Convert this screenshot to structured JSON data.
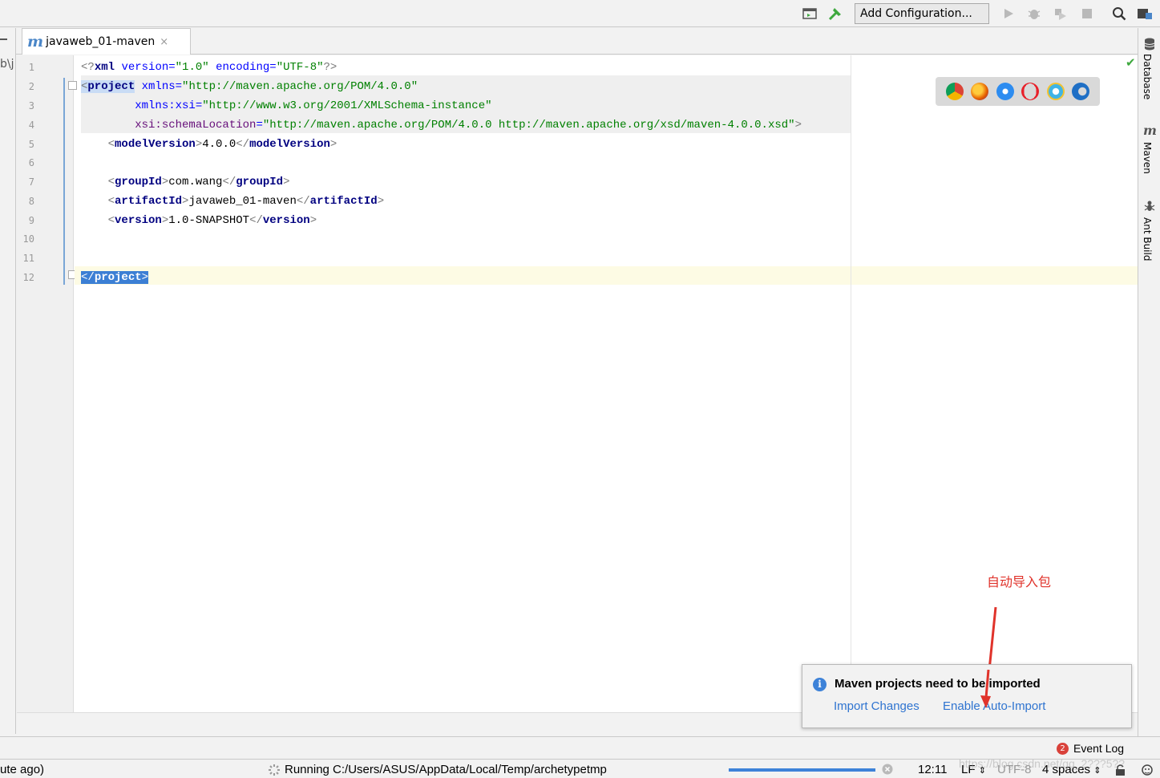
{
  "toolbar": {
    "add_configuration_label": "Add Configuration...",
    "icons": [
      "project-structure-icon",
      "build-hammer-icon",
      "run-icon",
      "debug-icon",
      "coverage-icon",
      "stop-icon",
      "search-icon",
      "project-settings-icon"
    ]
  },
  "left_edge": {
    "clipped_text": "b\\j"
  },
  "tab": {
    "prefix": "m",
    "label": "javaweb_01-maven",
    "close": "×"
  },
  "editor": {
    "line_numbers": [
      "1",
      "2",
      "3",
      "4",
      "5",
      "6",
      "7",
      "8",
      "9",
      "10",
      "11",
      "12"
    ],
    "lines": [
      [
        "<?",
        "xml",
        " ",
        "version",
        "=",
        "\"1.0\"",
        " ",
        "encoding",
        "=",
        "\"UTF-8\"",
        "?>"
      ],
      [
        "<",
        "project",
        " ",
        "xmlns",
        "=",
        "\"http://maven.apache.org/POM/4.0.0\""
      ],
      [
        "        ",
        "xmlns:xsi",
        "=",
        "\"http://www.w3.org/2001/XMLSchema-instance\""
      ],
      [
        "        ",
        "xsi:schemaLocation",
        "=",
        "\"http://maven.apache.org/POM/4.0.0 http://maven.apache.org/xsd/maven-4.0.0.xsd\"",
        ">"
      ],
      [
        "    ",
        "<",
        "modelVersion",
        ">",
        "4.0.0",
        "</",
        "modelVersion",
        ">"
      ],
      [
        ""
      ],
      [
        "    ",
        "<",
        "groupId",
        ">",
        "com.wang",
        "</",
        "groupId",
        ">"
      ],
      [
        "    ",
        "<",
        "artifactId",
        ">",
        "javaweb_01-maven",
        "</",
        "artifactId",
        ">"
      ],
      [
        "    ",
        "<",
        "version",
        ">",
        "1.0-SNAPSHOT",
        "</",
        "version",
        ">"
      ],
      [
        ""
      ],
      [
        ""
      ],
      [
        "</",
        "project",
        ">"
      ]
    ]
  },
  "right_sidebar": {
    "database": "Database",
    "maven": "Maven",
    "ant_build": "Ant Build",
    "maven_icon_glyph": "m"
  },
  "notification": {
    "title": "Maven projects need to be imported",
    "import_changes": "Import Changes",
    "enable_auto_import": "Enable Auto-Import",
    "info_glyph": "i"
  },
  "annotation": {
    "text": "自动导入包",
    "color": "#e0332b"
  },
  "tool_strip": {
    "event_log_label": "Event Log",
    "event_log_count": "2"
  },
  "status_bar": {
    "left_clipped": "ute ago)",
    "running_text": "Running C:/Users/ASUS/AppData/Local/Temp/archetypetmp",
    "progress": 1.0,
    "caret_position": "12:11",
    "line_separator": "LF",
    "encoding": "UTF-8",
    "indent": "4 spaces"
  },
  "watermark": "https://blog.csdn.net/qq_2???5??",
  "colors": {
    "accent": "#3d82d8",
    "link": "#2f74d0",
    "tag_name": "#000080",
    "attr": "#0000ff",
    "string": "#008000"
  }
}
